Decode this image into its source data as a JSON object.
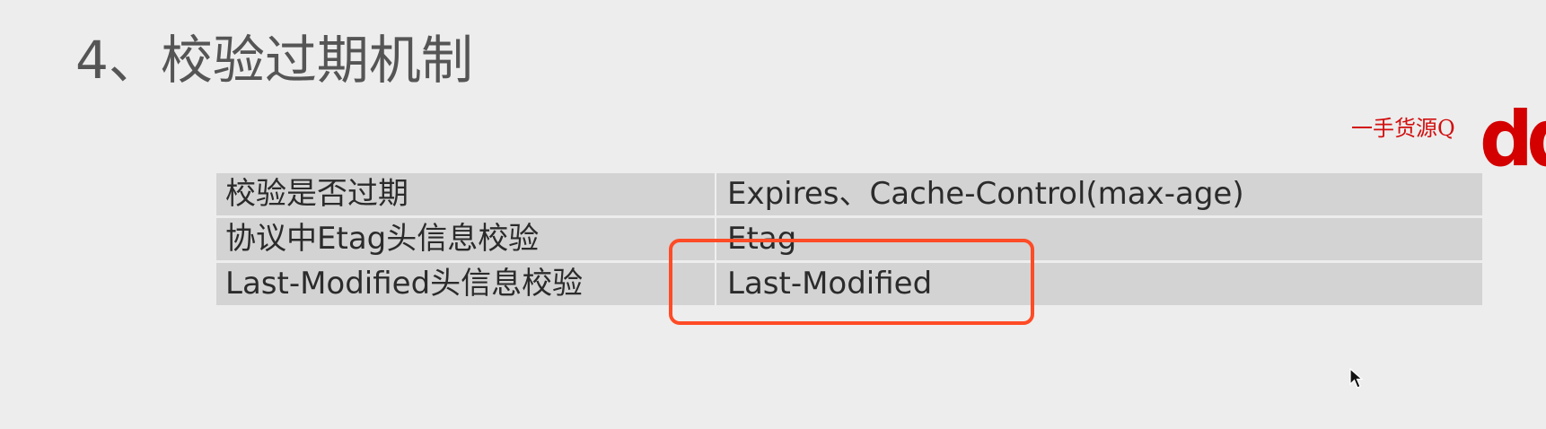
{
  "slide": {
    "title": "4、校验过期机制",
    "watermark_text": "一手货源Q",
    "watermark_logo": "dd",
    "table": [
      {
        "left": "校验是否过期",
        "right": "Expires、Cache-Control(max-age)"
      },
      {
        "left": "协议中Etag头信息校验",
        "right": "Etag"
      },
      {
        "left": "Last-Modified头信息校验",
        "right": "Last-Modified"
      }
    ]
  },
  "icons": {
    "cursor": "cursor-arrow-icon"
  },
  "colors": {
    "background": "#ededed",
    "table_cell": "#d3d3d3",
    "highlight": "#ff4b26",
    "watermark": "#d20f0f"
  }
}
